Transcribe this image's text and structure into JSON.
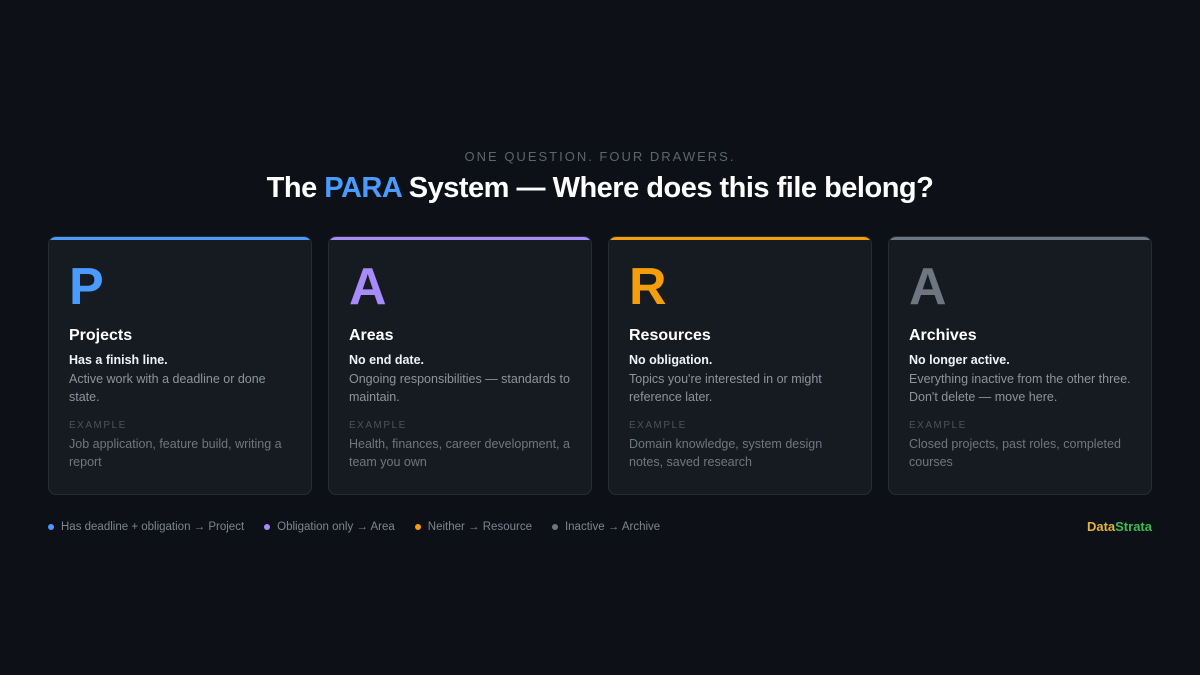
{
  "header": {
    "eyebrow": "ONE QUESTION. FOUR DRAWERS.",
    "title_prefix": "The ",
    "title_accent": "PARA",
    "title_suffix": " System — Where does this file belong?",
    "accent_color": "#4b9bff"
  },
  "cards": [
    {
      "letter": "P",
      "name": "Projects",
      "lead": "Has a finish line.",
      "description": "Active work with a deadline or done state.",
      "example_label": "EXAMPLE",
      "example": "Job application, feature build, writing a report",
      "color": "#4b9bff"
    },
    {
      "letter": "A",
      "name": "Areas",
      "lead": "No end date.",
      "description": "Ongoing responsibilities — standards to maintain.",
      "example_label": "EXAMPLE",
      "example": "Health, finances, career development, a team you own",
      "color": "#a78bfa"
    },
    {
      "letter": "R",
      "name": "Resources",
      "lead": "No obligation.",
      "description": "Topics you're interested in or might reference later.",
      "example_label": "EXAMPLE",
      "example": "Domain knowledge, system design notes, saved research",
      "color": "#f59e0b"
    },
    {
      "letter": "A",
      "name": "Archives",
      "lead": "No longer active.",
      "description": "Everything inactive from the other three. Don't delete — move here.",
      "example_label": "EXAMPLE",
      "example": "Closed projects, past roles, completed courses",
      "color": "#6e7681"
    }
  ],
  "legend": [
    {
      "text": "Has deadline + obligation → Project",
      "color": "#4b9bff"
    },
    {
      "text": "Obligation only → Area",
      "color": "#a78bfa"
    },
    {
      "text": "Neither → Resource",
      "color": "#f59e0b"
    },
    {
      "text": "Inactive → Archive",
      "color": "#6e7681"
    }
  ],
  "brand": {
    "part1": "Data",
    "part2": "Strata",
    "color1": "#e3b341",
    "color2": "#3fb950"
  }
}
